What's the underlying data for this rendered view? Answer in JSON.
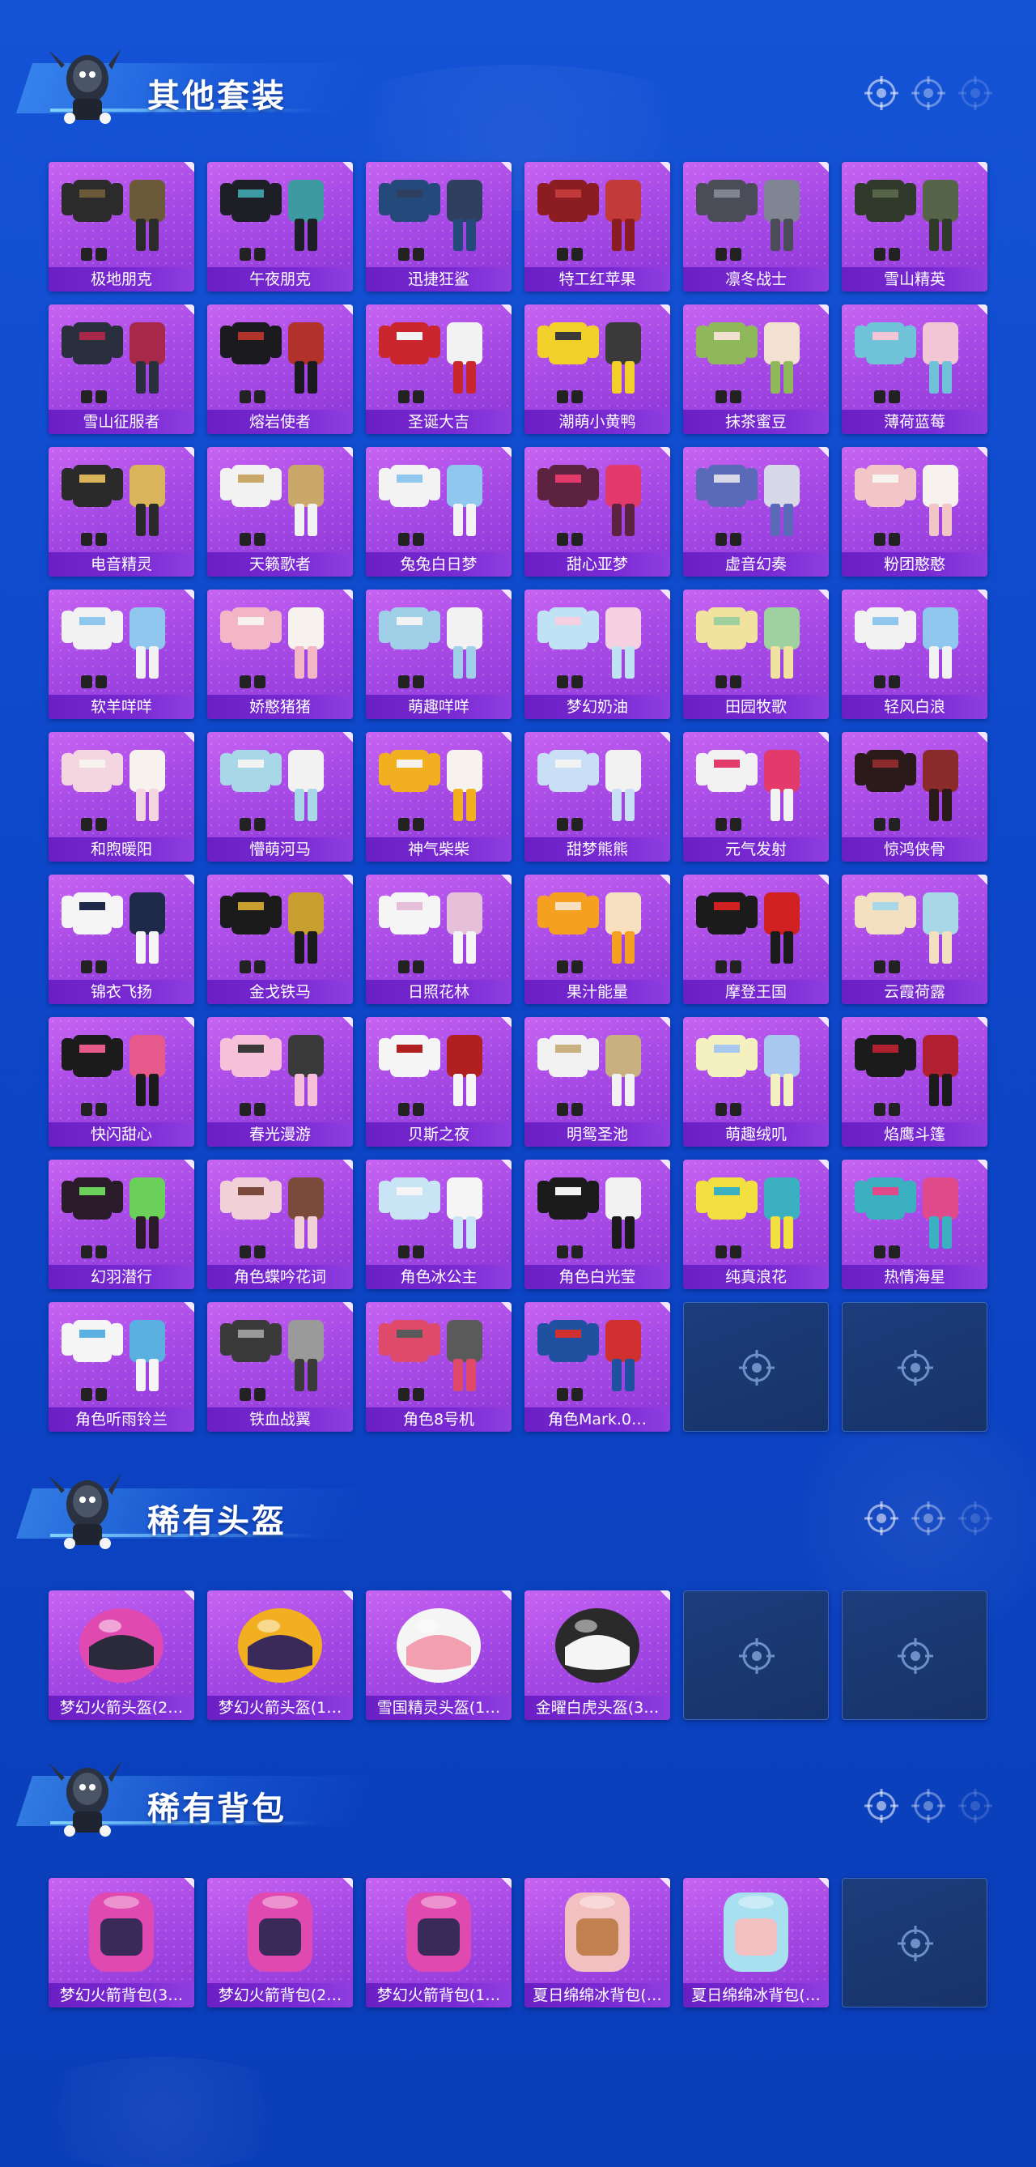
{
  "colors": {
    "background": "#1553d6",
    "card_purple": "#a84ae6",
    "card_label": "#6a1fc4",
    "empty_slot": "#1c3d7c",
    "title_text": "#ffffff"
  },
  "sections": [
    {
      "title": "其他套装",
      "items": [
        "极地朋克",
        "午夜朋克",
        "迅捷狂鲨",
        "特工红苹果",
        "凛冬战士",
        "雪山精英",
        "雪山征服者",
        "熔岩使者",
        "圣诞大吉",
        "潮萌小黄鸭",
        "抹茶蜜豆",
        "薄荷蓝莓",
        "电音精灵",
        "天籁歌者",
        "兔兔白日梦",
        "甜心亚梦",
        "虚音幻奏",
        "粉团憨憨",
        "软羊咩咩",
        "娇憨猪猪",
        "萌趣咩咩",
        "梦幻奶油",
        "田园牧歌",
        "轻风白浪",
        "和煦暖阳",
        "懵萌河马",
        "神气柴柴",
        "甜梦熊熊",
        "元气发射",
        "惊鸿侠骨",
        "锦衣飞扬",
        "金戈铁马",
        "日照花林",
        "果汁能量",
        "摩登王国",
        "云霞荷露",
        "快闪甜心",
        "春光漫游",
        "贝斯之夜",
        "明鸳圣池",
        "萌趣绒叽",
        "焰鹰斗篷",
        "幻羽潜行",
        "角色蝶吟花词",
        "角色冰公主",
        "角色白光莹",
        "纯真浪花",
        "热情海星",
        "角色听雨铃兰",
        "铁血战翼",
        "角色8号机",
        "角色Mark.0…"
      ],
      "empty_slots": 2
    },
    {
      "title": "稀有头盔",
      "items": [
        "梦幻火箭头盔(2…",
        "梦幻火箭头盔(1…",
        "雪国精灵头盔(1…",
        "金曜白虎头盔(3…"
      ],
      "empty_slots": 2
    },
    {
      "title": "稀有背包",
      "items": [
        "梦幻火箭背包(3…",
        "梦幻火箭背包(2…",
        "梦幻火箭背包(1…",
        "夏日绵绵冰背包(…",
        "夏日绵绵冰背包(…"
      ],
      "empty_slots": 1
    }
  ]
}
